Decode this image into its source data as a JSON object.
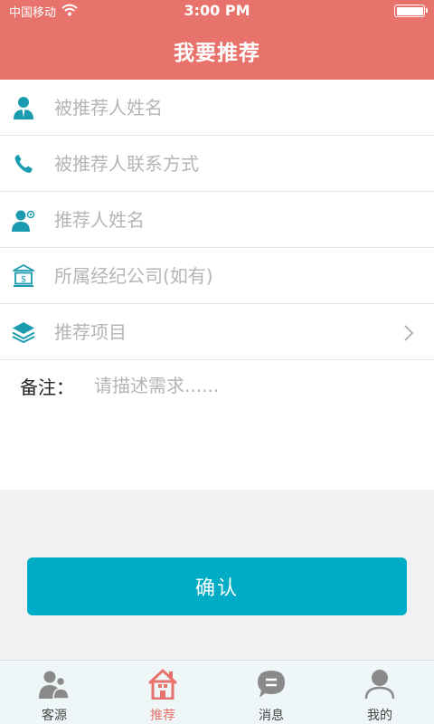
{
  "status": {
    "carrier": "中国移动",
    "time": "3:00 PM"
  },
  "header": {
    "title": "我要推荐"
  },
  "form": {
    "referee_name": {
      "placeholder": "被推荐人姓名",
      "icon": "person-icon"
    },
    "referee_contact": {
      "placeholder": "被推荐人联系方式",
      "icon": "phone-icon"
    },
    "referrer_name": {
      "placeholder": "推荐人姓名",
      "icon": "person-badge-icon"
    },
    "agency": {
      "placeholder": "所属经纪公司(如有)",
      "icon": "bank-icon"
    },
    "project": {
      "placeholder": "推荐项目",
      "icon": "layers-icon"
    },
    "remark": {
      "label": "备注：",
      "placeholder": "请描述需求......"
    }
  },
  "confirm_label": "确认",
  "tabs": [
    {
      "label": "客源",
      "icon": "clients-icon"
    },
    {
      "label": "推荐",
      "icon": "home-icon",
      "active": true
    },
    {
      "label": "消息",
      "icon": "message-icon"
    },
    {
      "label": "我的",
      "icon": "profile-icon"
    }
  ],
  "colors": {
    "header": "#e8736c",
    "accent": "#00acc6",
    "icon_teal": "#1a9bb0"
  }
}
